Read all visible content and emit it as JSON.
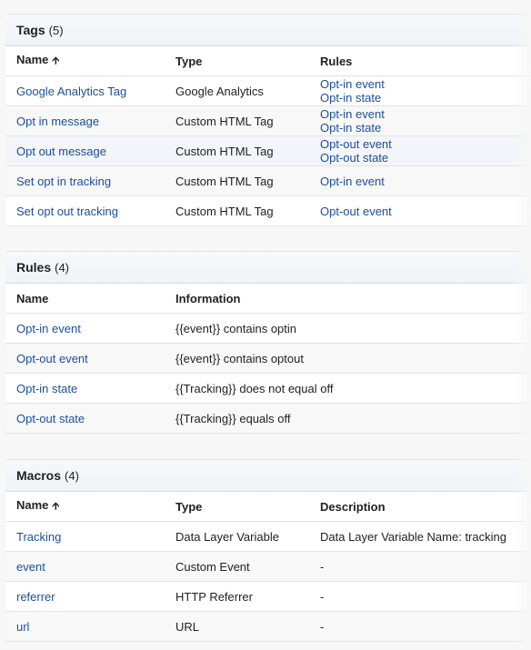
{
  "tags": {
    "title": "Tags",
    "count": "(5)",
    "columns": [
      "Name",
      "Type",
      "Rules"
    ],
    "sort_icon": "arrow-up-icon",
    "rows": [
      {
        "name": "Google Analytics Tag",
        "type": "Google Analytics",
        "rules": [
          "Opt-in event",
          "Opt-in state"
        ]
      },
      {
        "name": "Opt in message",
        "type": "Custom HTML Tag",
        "rules": [
          "Opt-in event",
          "Opt-in state"
        ]
      },
      {
        "name": "Opt out message",
        "type": "Custom HTML Tag",
        "rules": [
          "Opt-out event",
          "Opt-out state"
        ]
      },
      {
        "name": "Set opt in tracking",
        "type": "Custom HTML Tag",
        "rules": [
          "Opt-in event"
        ]
      },
      {
        "name": "Set opt out tracking",
        "type": "Custom HTML Tag",
        "rules": [
          "Opt-out event"
        ]
      }
    ]
  },
  "rules": {
    "title": "Rules",
    "count": "(4)",
    "columns": [
      "Name",
      "Information"
    ],
    "rows": [
      {
        "name": "Opt-in event",
        "info": "{{event}} contains optin"
      },
      {
        "name": "Opt-out event",
        "info": "{{event}} contains optout"
      },
      {
        "name": "Opt-in state",
        "info": "{{Tracking}} does not equal off"
      },
      {
        "name": "Opt-out state",
        "info": "{{Tracking}} equals off"
      }
    ]
  },
  "macros": {
    "title": "Macros",
    "count": "(4)",
    "columns": [
      "Name",
      "Type",
      "Description"
    ],
    "rows": [
      {
        "name": "Tracking",
        "type": "Data Layer Variable",
        "desc": "Data Layer Variable Name: tracking"
      },
      {
        "name": "event",
        "type": "Custom Event",
        "desc": "-"
      },
      {
        "name": "referrer",
        "type": "HTTP Referrer",
        "desc": "-"
      },
      {
        "name": "url",
        "type": "URL",
        "desc": "-"
      }
    ]
  }
}
